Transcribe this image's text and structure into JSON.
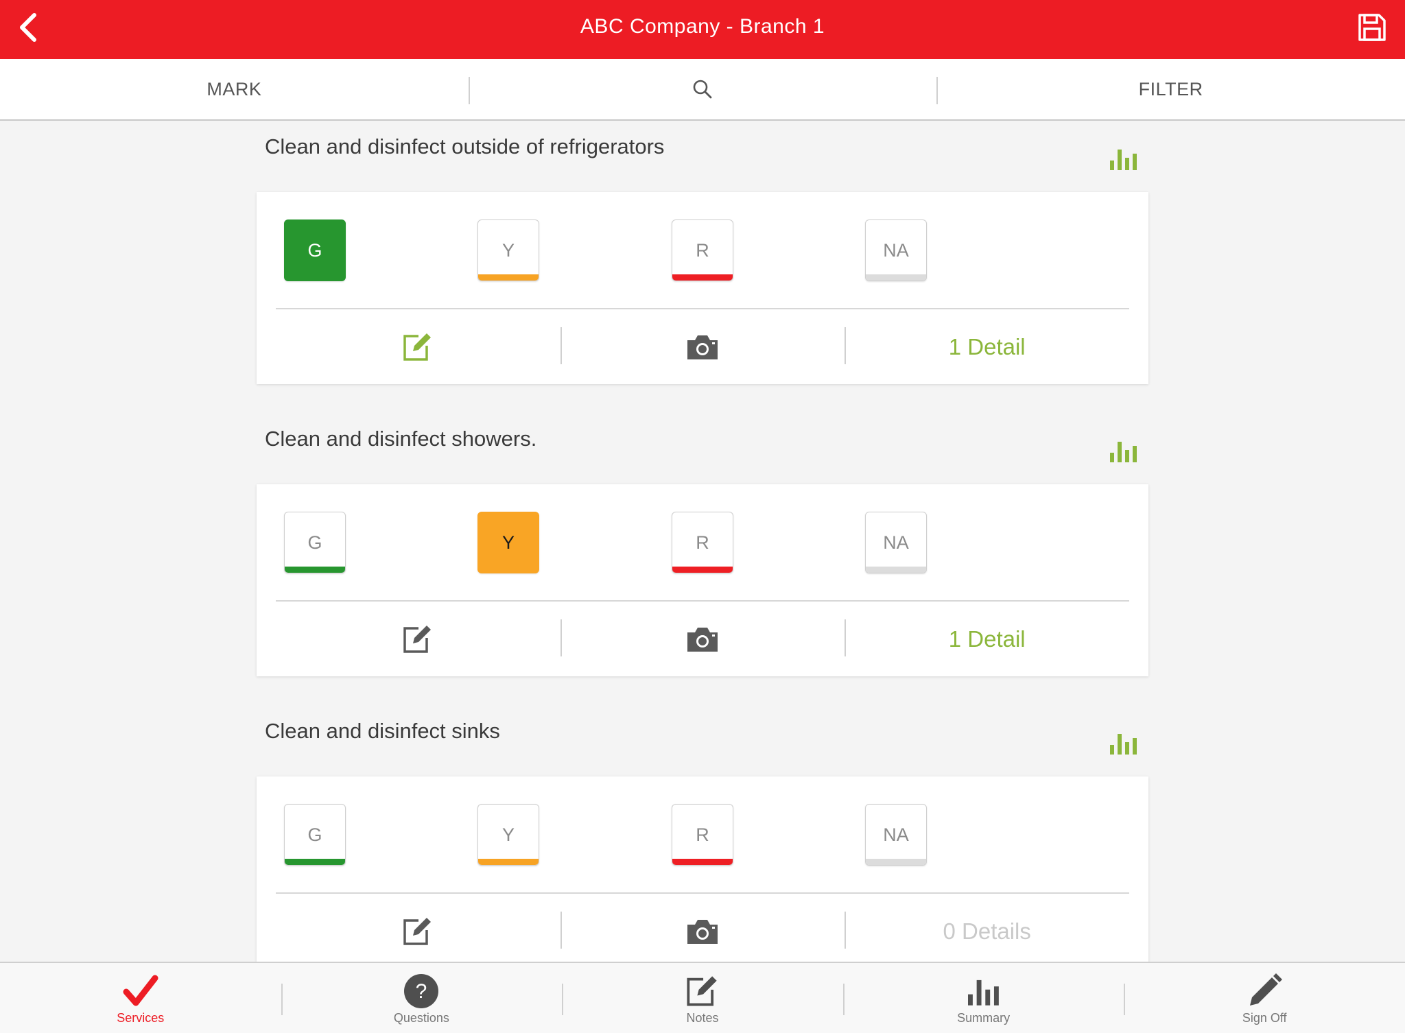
{
  "header": {
    "title": "ABC Company - Branch 1",
    "back_icon": "chevron-left-icon",
    "save_icon": "floppy-disk-icon"
  },
  "toolbar": {
    "mark_label": "MARK",
    "search_icon": "search-icon",
    "filter_label": "FILTER"
  },
  "questions": [
    {
      "title": "Clean and disinfect outside of refrigerators",
      "grades": [
        "G",
        "Y",
        "R",
        "NA"
      ],
      "selected": "G",
      "notes_icon_color": "#8bb63b",
      "details_label": "1 Detail"
    },
    {
      "title": "Clean and disinfect showers.",
      "grades": [
        "G",
        "Y",
        "R",
        "NA"
      ],
      "selected": "Y",
      "notes_icon_color": "#5a5a5a",
      "details_label": "1 Detail"
    },
    {
      "title": "Clean and disinfect sinks",
      "grades": [
        "G",
        "Y",
        "R",
        "NA"
      ],
      "selected": null,
      "notes_icon_color": "#5a5a5a",
      "details_label": "0 Details"
    }
  ],
  "bottom_nav": [
    {
      "label": "Services",
      "icon": "checkmark-icon",
      "active": true
    },
    {
      "label": "Questions",
      "icon": "question-circle-icon",
      "active": false
    },
    {
      "label": "Notes",
      "icon": "edit-note-icon",
      "active": false
    },
    {
      "label": "Summary",
      "icon": "bar-chart-icon",
      "active": false
    },
    {
      "label": "Sign Off",
      "icon": "pencil-icon",
      "active": false
    }
  ],
  "colors": {
    "brand_red": "#ed1c24",
    "green": "#27962f",
    "yellow": "#f9a525",
    "red": "#ee1f24",
    "accent_green": "#8bb63b"
  }
}
